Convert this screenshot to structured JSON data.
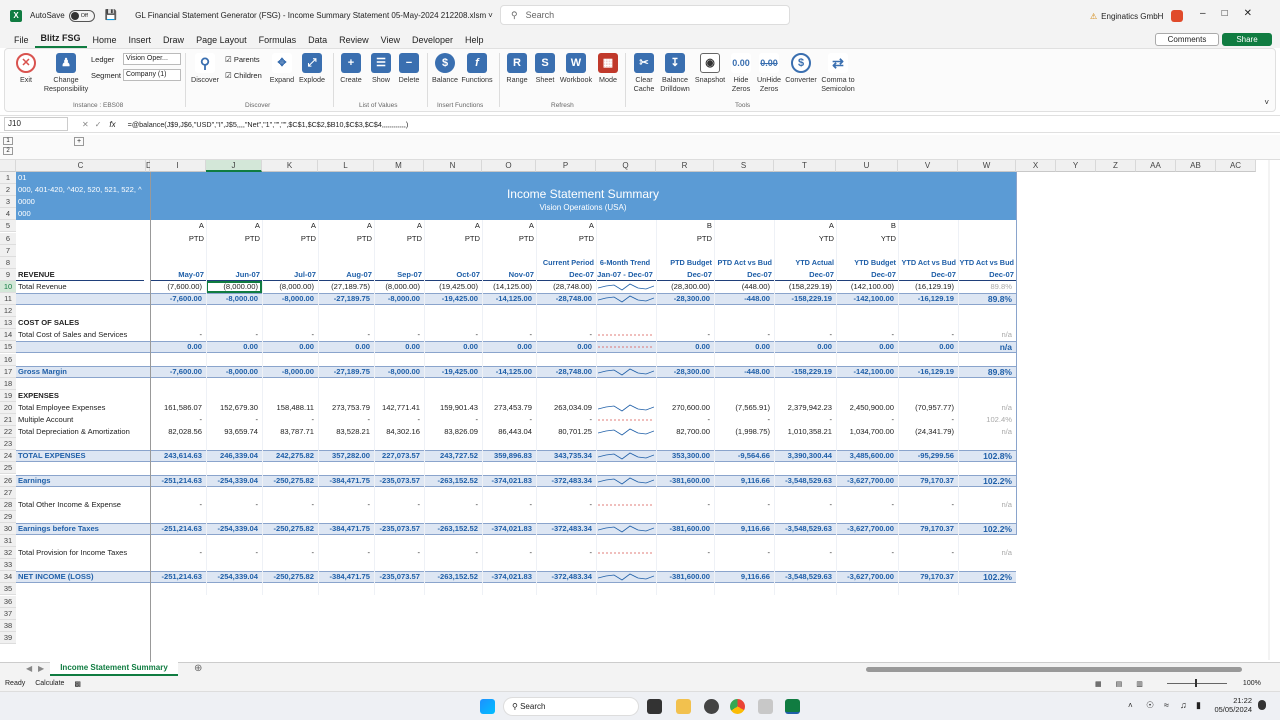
{
  "titlebar": {
    "autosave": "AutoSave",
    "autosave_state": "Off",
    "title": "GL Financial Statement Generator (FSG) - Income Summary Statement 05-May-2024 212208.xlsm",
    "search_placeholder": "Search",
    "account": "Enginatics GmbH"
  },
  "menu": [
    "File",
    "Blitz FSG",
    "Home",
    "Insert",
    "Draw",
    "Page Layout",
    "Formulas",
    "Data",
    "Review",
    "View",
    "Developer",
    "Help"
  ],
  "menu_right": {
    "comments": "Comments",
    "share": "Share"
  },
  "ribbon": {
    "exit": "Exit",
    "change_resp": "Change Responsibility",
    "ledger_label": "Ledger",
    "ledger_value": "Vision Oper...",
    "segment_label": "Segment",
    "segment_value": "Company (1)",
    "instance": "Instance : EBS08",
    "discover": "Discover",
    "parents": "Parents",
    "children": "Children",
    "expand": "Expand",
    "explode": "Explode",
    "discover_group": "Discover",
    "create": "Create",
    "show": "Show",
    "delete": "Delete",
    "lov_group": "List of Values",
    "balance": "Balance",
    "functions": "Functions",
    "insert_fn_group": "Insert Functions",
    "range": "Range",
    "sheet": "Sheet",
    "workbook": "Workbook",
    "mode": "Mode",
    "refresh_group": "Refresh",
    "clear_cache": "Clear Cache",
    "balance_drilldown": "Balance Drilldown",
    "snapshot": "Snapshot",
    "hide_zeros": "Hide Zeros",
    "unhide_zeros": "UnHide Zeros",
    "converter": "Converter",
    "comma": "Comma to Semicolon",
    "tools_group": "Tools"
  },
  "formula": {
    "namebox": "J10",
    "fx": "fx",
    "text": "=@balance(J$9,J$6,\"USD\",\"I\",J$5,,,,\"Net\",\"1\",\"\",\"\",$C$1,$C$2,$B10,$C$3,$C$4,,,,,,,,,,,,)"
  },
  "columns": [
    "C",
    "D",
    "I",
    "J",
    "K",
    "L",
    "M",
    "N",
    "O",
    "P",
    "Q",
    "R",
    "S",
    "T",
    "U",
    "V",
    "W",
    "X",
    "Y",
    "Z",
    "AA",
    "AB",
    "AC"
  ],
  "banner": {
    "title": "Income Statement Summary",
    "subtitle": "Vision Operations (USA)"
  },
  "params": [
    "01",
    "000, 401-420, ^402, 520, 521, 522, ^",
    "0000",
    "000"
  ],
  "row5": [
    "A",
    "A",
    "A",
    "A",
    "A",
    "A",
    "A",
    "A",
    "",
    "B",
    "",
    "A",
    "B"
  ],
  "row6": [
    "PTD",
    "PTD",
    "PTD",
    "PTD",
    "PTD",
    "PTD",
    "PTD",
    "PTD",
    "",
    "PTD",
    "",
    "YTD",
    "YTD"
  ],
  "row8": [
    "",
    "",
    "",
    "",
    "",
    "",
    "",
    "Current Period",
    "6-Month Trend",
    "PTD Budget",
    "PTD Act vs Bud",
    "YTD Actual",
    "YTD Budget",
    "YTD Act vs Bud",
    "YTD Act vs Bud"
  ],
  "row9": [
    "May-07",
    "Jun-07",
    "Jul-07",
    "Aug-07",
    "Sep-07",
    "Oct-07",
    "Nov-07",
    "Dec-07",
    "Jan-07 - Dec-07",
    "Dec-07",
    "Dec-07",
    "Dec-07",
    "Dec-07",
    "Dec-07",
    "Dec-07"
  ],
  "rows": [
    {
      "n": "9",
      "label": "REVENUE",
      "bold": true
    },
    {
      "n": "10",
      "label": "Total  Revenue",
      "vals": [
        "(7,600.00)",
        "(8,000.00)",
        "(8,000.00)",
        "(27,189.75)",
        "(8,000.00)",
        "(19,425.00)",
        "(14,125.00)",
        "(28,748.00)",
        "~",
        "(28,300.00)",
        "(448.00)",
        "(158,229.19)",
        "(142,100.00)",
        "(16,129.19)",
        "89.8%"
      ]
    },
    {
      "n": "11",
      "label": "",
      "band": true,
      "vals": [
        "-7,600.00",
        "-8,000.00",
        "-8,000.00",
        "-27,189.75",
        "-8,000.00",
        "-19,425.00",
        "-14,125.00",
        "-28,748.00",
        "~",
        "-28,300.00",
        "-448.00",
        "-158,229.19",
        "-142,100.00",
        "-16,129.19",
        "89.8%"
      ]
    },
    {
      "n": "12",
      "label": ""
    },
    {
      "n": "13",
      "label": "COST OF SALES",
      "bold": true
    },
    {
      "n": "14",
      "label": "Total Cost of Sales and Services",
      "vals": [
        "-",
        "-",
        "-",
        "-",
        "-",
        "-",
        "-",
        "-",
        "~",
        "-",
        "-",
        "-",
        "-",
        "-",
        "n/a"
      ]
    },
    {
      "n": "15",
      "label": "",
      "band": true,
      "vals": [
        "0.00",
        "0.00",
        "0.00",
        "0.00",
        "0.00",
        "0.00",
        "0.00",
        "0.00",
        "~",
        "0.00",
        "0.00",
        "0.00",
        "0.00",
        "0.00",
        "n/a"
      ]
    },
    {
      "n": "16",
      "label": ""
    },
    {
      "n": "17",
      "label": "Gross Margin",
      "band": true,
      "blue": true,
      "vals": [
        "-7,600.00",
        "-8,000.00",
        "-8,000.00",
        "-27,189.75",
        "-8,000.00",
        "-19,425.00",
        "-14,125.00",
        "-28,748.00",
        "~",
        "-28,300.00",
        "-448.00",
        "-158,229.19",
        "-142,100.00",
        "-16,129.19",
        "89.8%"
      ]
    },
    {
      "n": "18",
      "label": ""
    },
    {
      "n": "19",
      "label": "EXPENSES",
      "bold": true
    },
    {
      "n": "20",
      "label": "Total Employee Expenses",
      "vals": [
        "161,586.07",
        "152,679.30",
        "158,488.11",
        "273,753.79",
        "142,771.41",
        "159,901.43",
        "273,453.79",
        "263,034.09",
        "~",
        "270,600.00",
        "(7,565.91)",
        "2,379,942.23",
        "2,450,900.00",
        "(70,957.77)",
        "n/a"
      ]
    },
    {
      "n": "21",
      "label": "Multiple Account",
      "vals": [
        "-",
        "-",
        "-",
        "-",
        "-",
        "-",
        "-",
        "-",
        "~",
        "-",
        "-",
        "-",
        "-",
        "-",
        "102.4%"
      ]
    },
    {
      "n": "22",
      "label": "Total Depreciation & Amortization",
      "vals": [
        "82,028.56",
        "93,659.74",
        "83,787.71",
        "83,528.21",
        "84,302.16",
        "83,826.09",
        "86,443.04",
        "80,701.25",
        "~",
        "82,700.00",
        "(1,998.75)",
        "1,010,358.21",
        "1,034,700.00",
        "(24,341.79)",
        "n/a"
      ]
    },
    {
      "n": "23",
      "label": ""
    },
    {
      "n": "24",
      "label": "TOTAL EXPENSES",
      "band": true,
      "blue": true,
      "vals": [
        "243,614.63",
        "246,339.04",
        "242,275.82",
        "357,282.00",
        "227,073.57",
        "243,727.52",
        "359,896.83",
        "343,735.34",
        "~",
        "353,300.00",
        "-9,564.66",
        "3,390,300.44",
        "3,485,600.00",
        "-95,299.56",
        "102.8%"
      ]
    },
    {
      "n": "25",
      "label": ""
    },
    {
      "n": "26",
      "label": "Earnings",
      "band": true,
      "blue": true,
      "vals": [
        "-251,214.63",
        "-254,339.04",
        "-250,275.82",
        "-384,471.75",
        "-235,073.57",
        "-263,152.52",
        "-374,021.83",
        "-372,483.34",
        "~",
        "-381,600.00",
        "9,116.66",
        "-3,548,529.63",
        "-3,627,700.00",
        "79,170.37",
        "102.2%"
      ]
    },
    {
      "n": "27",
      "label": ""
    },
    {
      "n": "28",
      "label": "Total Other Income & Expense",
      "vals": [
        "-",
        "-",
        "-",
        "-",
        "-",
        "-",
        "-",
        "-",
        "~",
        "-",
        "-",
        "-",
        "-",
        "-",
        "n/a"
      ]
    },
    {
      "n": "29",
      "label": ""
    },
    {
      "n": "30",
      "label": "Earnings before Taxes",
      "band": true,
      "blue": true,
      "vals": [
        "-251,214.63",
        "-254,339.04",
        "-250,275.82",
        "-384,471.75",
        "-235,073.57",
        "-263,152.52",
        "-374,021.83",
        "-372,483.34",
        "~",
        "-381,600.00",
        "9,116.66",
        "-3,548,529.63",
        "-3,627,700.00",
        "79,170.37",
        "102.2%"
      ]
    },
    {
      "n": "31",
      "label": ""
    },
    {
      "n": "32",
      "label": "Total Provision for Income Taxes",
      "vals": [
        "-",
        "-",
        "-",
        "-",
        "-",
        "-",
        "-",
        "-",
        "~",
        "-",
        "-",
        "-",
        "-",
        "-",
        "n/a"
      ]
    },
    {
      "n": "33",
      "label": ""
    },
    {
      "n": "34",
      "label": "NET INCOME (LOSS)",
      "band": true,
      "blue": true,
      "vals": [
        "-251,214.63",
        "-254,339.04",
        "-250,275.82",
        "-384,471.75",
        "-235,073.57",
        "-263,152.52",
        "-374,021.83",
        "-372,483.34",
        "~",
        "-381,600.00",
        "9,116.66",
        "-3,548,529.63",
        "-3,627,700.00",
        "79,170.37",
        "102.2%"
      ]
    },
    {
      "n": "35",
      "label": ""
    },
    {
      "n": "36",
      "label": ""
    },
    {
      "n": "37",
      "label": ""
    },
    {
      "n": "38",
      "label": ""
    },
    {
      "n": "39",
      "label": ""
    }
  ],
  "sheet_tab": "Income Statement Summary",
  "status": {
    "ready": "Ready",
    "calculate": "Calculate",
    "zoom": "100%"
  },
  "taskbar": {
    "search": "Search",
    "time": "21:22",
    "date": "05/05/2024"
  }
}
